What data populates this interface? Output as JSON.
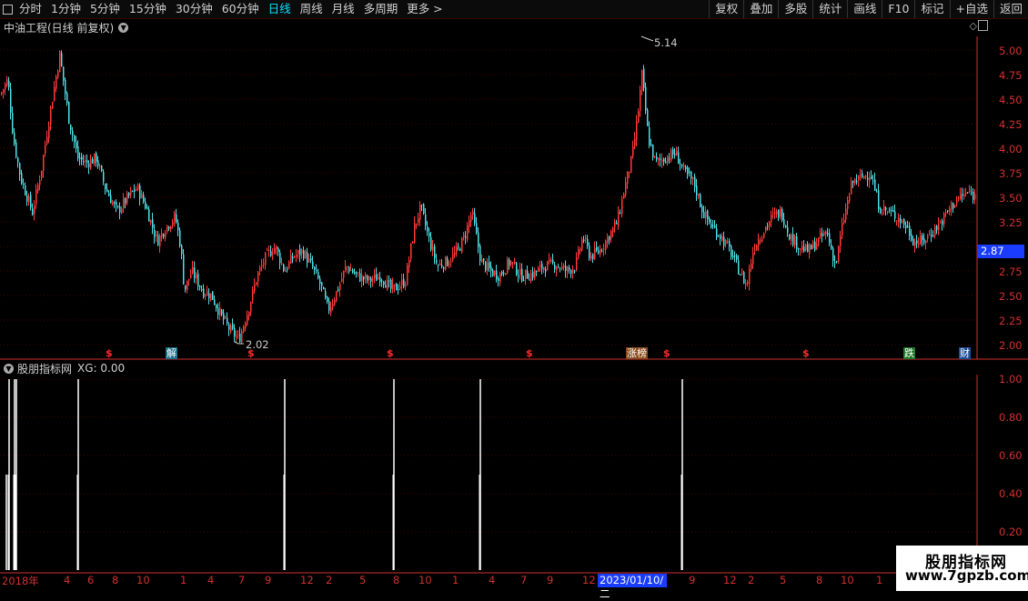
{
  "toolbar": {
    "periods": [
      "分时",
      "1分钟",
      "5分钟",
      "15分钟",
      "30分钟",
      "60分钟",
      "日线",
      "周线",
      "月线",
      "多周期",
      "更多 >"
    ],
    "active": "日线",
    "buttons": [
      "复权",
      "叠加",
      "多股",
      "统计",
      "画线",
      "F10",
      "标记",
      "+自选",
      "返回"
    ]
  },
  "main": {
    "title": "中油工程(日线 前复权)",
    "price_axis": [
      "5.00",
      "4.75",
      "4.50",
      "4.25",
      "4.00",
      "3.75",
      "3.50",
      "3.25",
      "3.00",
      "2.75",
      "2.50",
      "2.25",
      "2.00"
    ],
    "high_label": "5.14",
    "low_label": "2.02",
    "current_price": "2.87",
    "markers": [
      {
        "type": "s",
        "text": "$"
      },
      {
        "type": "tag",
        "text": "解",
        "color": "#1e6f8a"
      },
      {
        "type": "s",
        "text": "$"
      },
      {
        "type": "s",
        "text": "$"
      },
      {
        "type": "s",
        "text": "$"
      },
      {
        "type": "tag",
        "text": "涨榜",
        "color": "#8a4a1a"
      },
      {
        "type": "s",
        "text": "$"
      },
      {
        "type": "s",
        "text": "$"
      },
      {
        "type": "tag",
        "text": "跌",
        "color": "#1e7a2a"
      },
      {
        "type": "tag",
        "text": "财",
        "color": "#1e4f9a"
      }
    ]
  },
  "indicator": {
    "title": "股朋指标网",
    "xg_label": "XG: 0.00",
    "axis": [
      "1.00",
      "0.80",
      "0.60",
      "0.40",
      "0.20"
    ]
  },
  "dates": {
    "labels": [
      "2018年",
      "4",
      "6",
      "8",
      "10",
      "1",
      "4",
      "7",
      "9",
      "12",
      "2",
      "5",
      "8",
      "10",
      "1",
      "4",
      "7",
      "9",
      "12",
      "9",
      "12",
      "2",
      "5",
      "8",
      "10",
      "1"
    ],
    "highlight": "2023/01/10/二"
  },
  "watermark": {
    "line1": "股朋指标网",
    "line2": "www.7gpzb.com"
  },
  "colors": {
    "up": "#ff3a3a",
    "down": "#4fe0e8",
    "axis": "#d23030",
    "grid": "#4a0000",
    "highlight": "#1a3cff"
  }
}
